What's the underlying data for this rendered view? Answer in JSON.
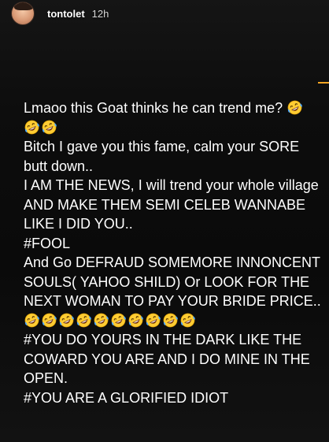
{
  "story": {
    "username": "tontolet",
    "time_ago": "12h"
  },
  "caption": {
    "line1": "Lmaoo this Goat thinks he can trend me?",
    "line3": "Bitch I gave you this fame, calm your SORE",
    "line4": "butt down..",
    "line5": "I AM THE NEWS, I will trend your whole village",
    "line6": "AND MAKE THEM SEMI CELEB WANNABE",
    "line7": "LIKE I DID YOU..",
    "line8": "#FOOL",
    "line9": "And Go DEFRAUD SOMEMORE INNONCENT",
    "line10": "SOULS( YAHOO SHILD) Or LOOK FOR THE",
    "line11": "NEXT WOMAN TO PAY YOUR BRIDE PRICE..",
    "line13": "#YOU DO YOURS IN THE DARK LIKE THE",
    "line14": "COWARD YOU ARE AND I DO MINE IN THE",
    "line15": "OPEN.",
    "line16": "#YOU ARE A GLORIFIED IDIOT"
  },
  "emojis": {
    "icon": "rolling-on-the-floor-laughing-emoji",
    "after_line1": 1,
    "line2_count": 2,
    "line12_count": 10
  },
  "colors": {
    "background": "#0b0b0b",
    "text": "#ffffff",
    "timestamp": "#d7d7d7",
    "emoji_face": "#ffcc33",
    "accent_mark": "#f6a623"
  }
}
